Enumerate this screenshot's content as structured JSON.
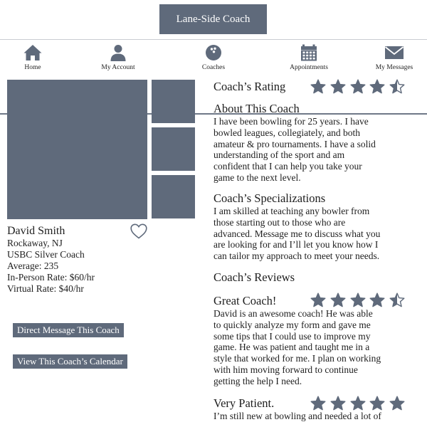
{
  "header": {
    "brand": "Lane-Side Coach"
  },
  "nav": {
    "items": [
      {
        "label": "Home",
        "icon": "home-icon"
      },
      {
        "label": "My Account",
        "icon": "user-icon"
      },
      {
        "label": "Coaches",
        "icon": "bowling-ball-icon"
      },
      {
        "label": "Appointments",
        "icon": "calendar-icon"
      },
      {
        "label": "My Messages",
        "icon": "envelope-icon"
      }
    ]
  },
  "colors": {
    "accent": "#5f6a7b",
    "text": "#1e1e1e",
    "background": "#ffffff"
  },
  "profile": {
    "name": "David Smith",
    "location": "Rockaway, NJ",
    "certification": "USBC Silver Coach",
    "average": "Average: 235",
    "in_person_rate": "In-Person Rate: $60/hr",
    "virtual_rate": "Virtual Rate: $40/hr",
    "favorite_icon": "heart-outline-icon"
  },
  "actions": {
    "message_button": "Direct Message This Coach",
    "calendar_button": "View This Coach’s Calendar"
  },
  "rating": {
    "label": "Coach’s Rating",
    "value": 4.5,
    "max": 5
  },
  "about": {
    "heading": "About This Coach",
    "lines": [
      "I have been bowling for 25 years. I have",
      "bowled leagues, collegiately, and both",
      "amateur & pro tournaments. I have a solid",
      "understanding of the sport and am",
      "confident that I can help you take your",
      "game to the next level."
    ]
  },
  "specializations": {
    "heading": "Coach’s Specializations",
    "lines": [
      "I am skilled at teaching any bowler from",
      "those starting out to those who are",
      "advanced. Message me to discuss what you",
      "are looking for and I’ll let you know how I",
      "can tailor my approach to meet your needs."
    ]
  },
  "reviews": {
    "heading": "Coach’s Reviews",
    "items": [
      {
        "title": "Great Coach!",
        "rating": 4.5,
        "lines": [
          "David is an awesome coach!  He was able",
          "to quickly analyze my form and gave me",
          "some tips that I could use to improve my",
          "game.  He was patient and taught me in a",
          "style that worked for me.  I plan on working",
          "with him moving forward to continue",
          "getting the help I need."
        ]
      },
      {
        "title": "Very Patient.",
        "rating": 5,
        "lines": [
          "I’m still new at bowling and needed a lot of"
        ]
      }
    ]
  }
}
